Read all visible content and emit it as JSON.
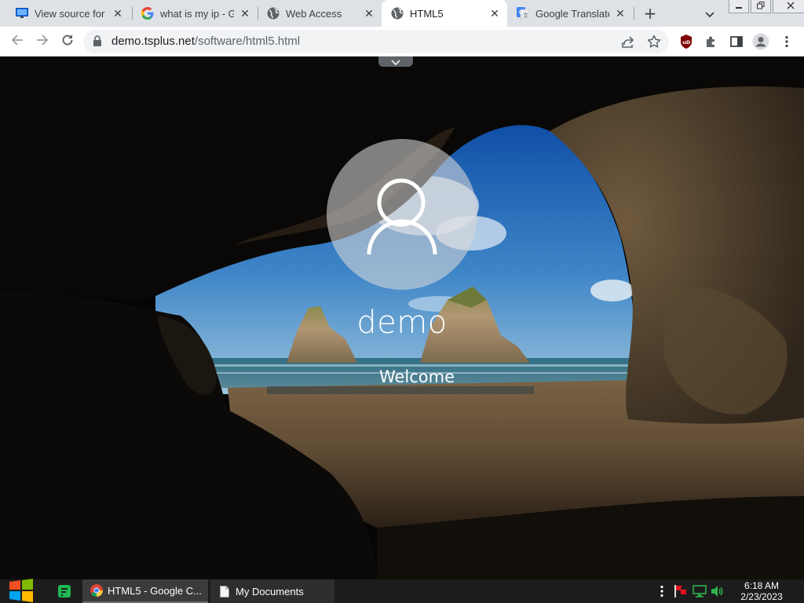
{
  "browser": {
    "tabs": [
      {
        "title": "View source for",
        "icon": "monitor-icon"
      },
      {
        "title": "what is my ip - G",
        "icon": "google-icon"
      },
      {
        "title": "Web Access",
        "icon": "globe-icon"
      },
      {
        "title": "HTML5",
        "icon": "globe-icon",
        "active": true
      },
      {
        "title": "Google Translate",
        "icon": "translate-icon"
      }
    ],
    "close_glyph": "✕",
    "new_tab_glyph": "+",
    "url_host": "demo.tsplus.net",
    "url_path": "/software/html5.html"
  },
  "login": {
    "username": "demo",
    "status": "Welcome"
  },
  "taskbar": {
    "items": [
      {
        "label": "HTML5 - Google C...",
        "icon": "chrome-icon"
      },
      {
        "label": "My Documents",
        "icon": "document-icon"
      }
    ],
    "clock_time": "6:18 AM",
    "clock_date": "2/23/2023"
  },
  "colors": {
    "tabstrip_bg": "#dee1e6",
    "toolbar_bg": "#ffffff",
    "taskbar_bg": "#1c1c1c",
    "ublock_red": "#800000"
  }
}
